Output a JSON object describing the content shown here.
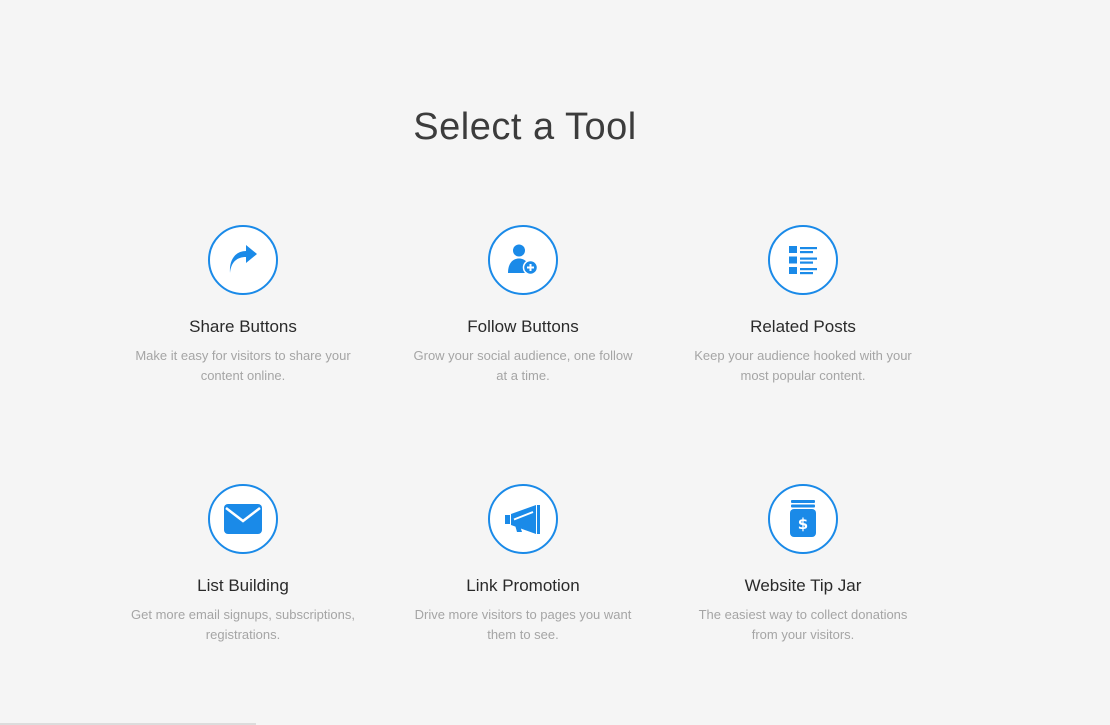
{
  "header": {
    "title": "Select a Tool"
  },
  "colors": {
    "accent": "#1a8ae8",
    "background": "#f5f5f5",
    "title_text": "#3c3c3c",
    "description_text": "#a5a5a5"
  },
  "tools": [
    {
      "name": "Share Buttons",
      "description": "Make it easy for visitors to share your content online.",
      "icon": "share-arrow-icon"
    },
    {
      "name": "Follow Buttons",
      "description": "Grow your social audience, one follow at a time.",
      "icon": "add-user-icon"
    },
    {
      "name": "Related Posts",
      "description": "Keep your audience hooked with your most popular content.",
      "icon": "list-icon"
    },
    {
      "name": "List Building",
      "description": "Get more email signups, subscriptions, registrations.",
      "icon": "envelope-icon"
    },
    {
      "name": "Link Promotion",
      "description": "Drive more visitors to pages you want them to see.",
      "icon": "megaphone-icon"
    },
    {
      "name": "Website Tip Jar",
      "description": "The easiest way to collect donations from your visitors.",
      "icon": "tip-jar-icon"
    }
  ]
}
